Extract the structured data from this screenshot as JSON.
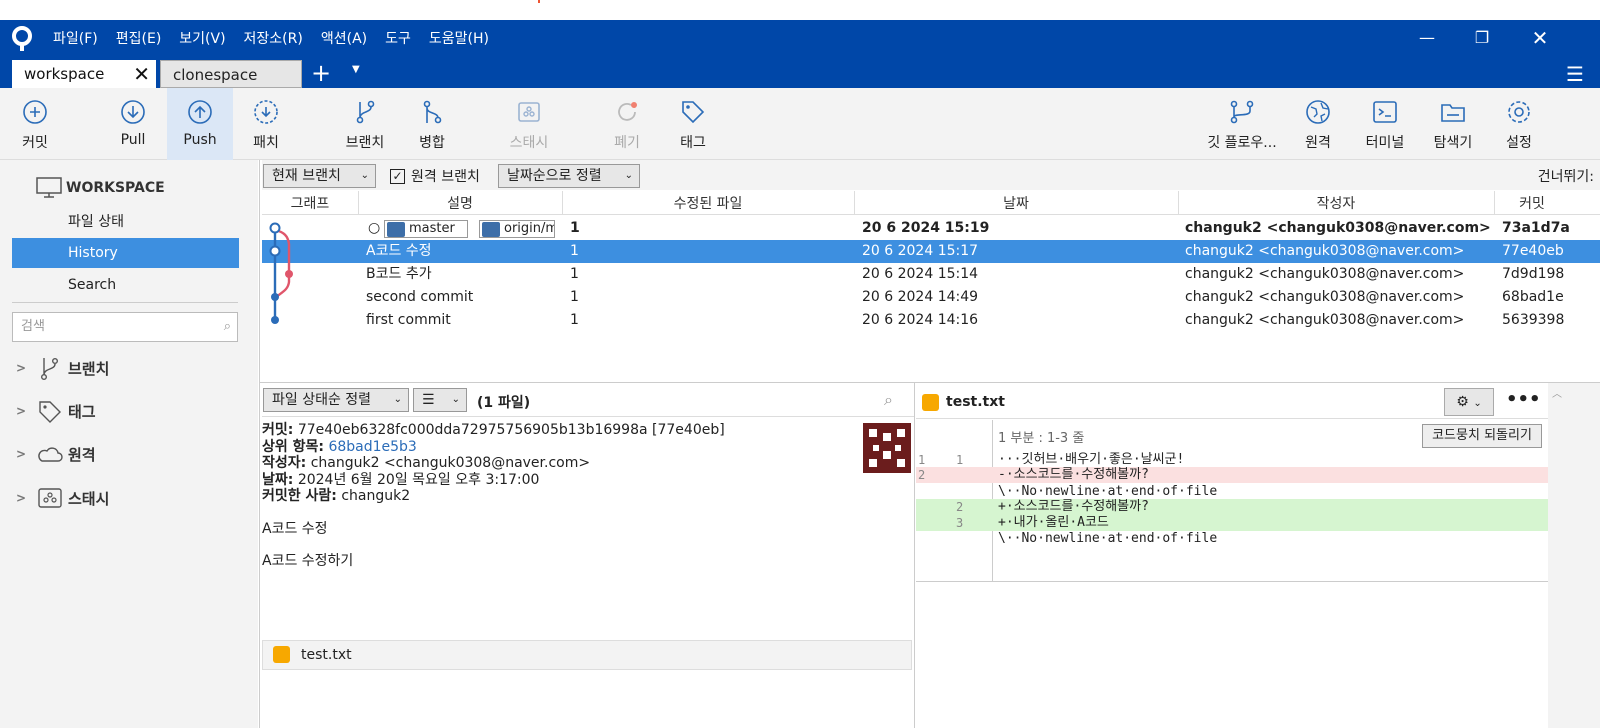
{
  "menu": [
    "파일(F)",
    "편집(E)",
    "보기(V)",
    "저장소(R)",
    "액션(A)",
    "도구",
    "도움말(H)"
  ],
  "tabs": {
    "active": "workspace",
    "other": "clonespace"
  },
  "toolbar": {
    "commit": "커밋",
    "pull": "Pull",
    "push": "Push",
    "patch": "패치",
    "branch": "브랜치",
    "merge": "병합",
    "stash": "스태시",
    "discard": "폐기",
    "tag": "태그",
    "gitflow": "깃 플로우...",
    "remote": "원격",
    "terminal": "터미널",
    "explorer": "탐색기",
    "settings": "설정"
  },
  "sidebar": {
    "workspace": "WORKSPACE",
    "file_status": "파일 상태",
    "history": "History",
    "search": "Search",
    "search_placeholder": "검색",
    "branches": "브랜치",
    "tags": "태그",
    "remotes": "원격",
    "stashes": "스태시"
  },
  "filter": {
    "branch_dd": "현재 브랜치",
    "remote_branch": "원격 브랜치",
    "sort_dd": "날짜순으로 정렬",
    "skip": "건너뛰기:"
  },
  "history": {
    "columns": {
      "graph": "그래프",
      "desc": "설명",
      "files": "수정된 파일",
      "date": "날짜",
      "author": "작성자",
      "commit": "커밋"
    },
    "rows": [
      {
        "desc": "",
        "branch_master": "master",
        "branch_origin": "origin/m",
        "files": "1",
        "date": "20 6 2024 15:19",
        "author": "changuk2 <changuk0308@naver.com>",
        "commit": "73a1d7a"
      },
      {
        "desc": "A코드 수정",
        "files": "1",
        "date": "20 6 2024 15:17",
        "author": "changuk2 <changuk0308@naver.com>",
        "commit": "77e40eb"
      },
      {
        "desc": "B코드 추가",
        "files": "1",
        "date": "20 6 2024 15:14",
        "author": "changuk2 <changuk0308@naver.com>",
        "commit": "7d9d198"
      },
      {
        "desc": "second commit",
        "files": "1",
        "date": "20 6 2024 14:49",
        "author": "changuk2 <changuk0308@naver.com>",
        "commit": "68bad1e"
      },
      {
        "desc": "first commit",
        "files": "1",
        "date": "20 6 2024 14:16",
        "author": "changuk2 <changuk0308@naver.com>",
        "commit": "5639398"
      }
    ]
  },
  "lower": {
    "sort_dd": "파일 상태순 정렬",
    "count": "(1 파일)"
  },
  "detail": {
    "commit_label": "커밋:",
    "commit_value": "77e40eb6328fc000dda72975756905b13b16998a [77e40eb]",
    "parent_label": "상위 항목:",
    "parent_value": "68bad1e5b3",
    "author_label": "작성자:",
    "author_value": "changuk2 <changuk0308@naver.com>",
    "date_label": "날짜:",
    "date_value": "2024년 6월 20일 목요일 오후 3:17:00",
    "committer_label": "커밋한 사람:",
    "committer_value": "changuk2",
    "message1": "A코드 수정",
    "message2": "A코드 수정하기"
  },
  "file": {
    "name": "test.txt"
  },
  "diff": {
    "filename": "test.txt",
    "hunk": "1 부분 : 1-3 줄",
    "revert": "코드뭉치 되돌리기",
    "lines": [
      {
        "n1": "1",
        "n2": "1",
        "text": "···깃허브·배우기·좋은·날씨군!",
        "kind": "ctx"
      },
      {
        "n1": "2",
        "n2": "",
        "text": "-·소스코드를·수정해볼까?",
        "kind": "del"
      },
      {
        "n1": "",
        "n2": "",
        "text": "\\··No·newline·at·end·of·file",
        "kind": "ctx"
      },
      {
        "n1": "",
        "n2": "2",
        "text": "+·소스코드를·수정해볼까?",
        "kind": "add"
      },
      {
        "n1": "",
        "n2": "3",
        "text": "+·내가·올린·A코드",
        "kind": "add"
      },
      {
        "n1": "",
        "n2": "",
        "text": "\\··No·newline·at·end·of·file",
        "kind": "ctx"
      }
    ]
  },
  "colors": {
    "titlebar": "#0047a8",
    "selection": "#3d8fe0",
    "accent": "#3d6ea8",
    "graph_blue": "#2b6cb8",
    "graph_red": "#e0566b"
  }
}
